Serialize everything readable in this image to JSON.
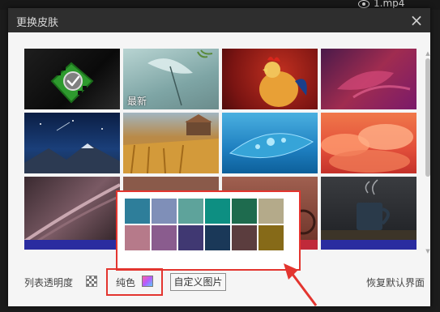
{
  "background": {
    "file_label": "1.mp4"
  },
  "dialog": {
    "title": "更换皮肤",
    "close_glyph": "×"
  },
  "skins": [
    {
      "id": "skin-1",
      "selected": true,
      "label": ""
    },
    {
      "id": "skin-2",
      "selected": false,
      "label": "最新"
    },
    {
      "id": "skin-3",
      "selected": false,
      "label": ""
    },
    {
      "id": "skin-4",
      "selected": false,
      "label": ""
    },
    {
      "id": "skin-5",
      "selected": false,
      "label": ""
    },
    {
      "id": "skin-6",
      "selected": false,
      "label": ""
    },
    {
      "id": "skin-7",
      "selected": false,
      "label": ""
    },
    {
      "id": "skin-8",
      "selected": false,
      "label": ""
    },
    {
      "id": "skin-9",
      "selected": false,
      "label": ""
    },
    {
      "id": "skin-10",
      "selected": false,
      "label": ""
    },
    {
      "id": "skin-11",
      "selected": false,
      "label": ""
    },
    {
      "id": "skin-12",
      "selected": false,
      "label": ""
    }
  ],
  "palette": {
    "colors": [
      "#2e7e9a",
      "#7f8fb8",
      "#5ea39b",
      "#0d8f82",
      "#1e6b4e",
      "#b4aa8a",
      "#b67a8a",
      "#8a5c8e",
      "#403872",
      "#1a3858",
      "#5b3d3e",
      "#866a18"
    ]
  },
  "footer": {
    "opacity_label": "列表透明度",
    "pure_color_label": "纯色",
    "custom_image_label": "自定义图片",
    "restore_label": "恢复默认界面"
  },
  "colors": {
    "accent_red": "#e3352f",
    "titlebar": "#2e2e2e",
    "dialog_bg": "#f5f5f5"
  }
}
